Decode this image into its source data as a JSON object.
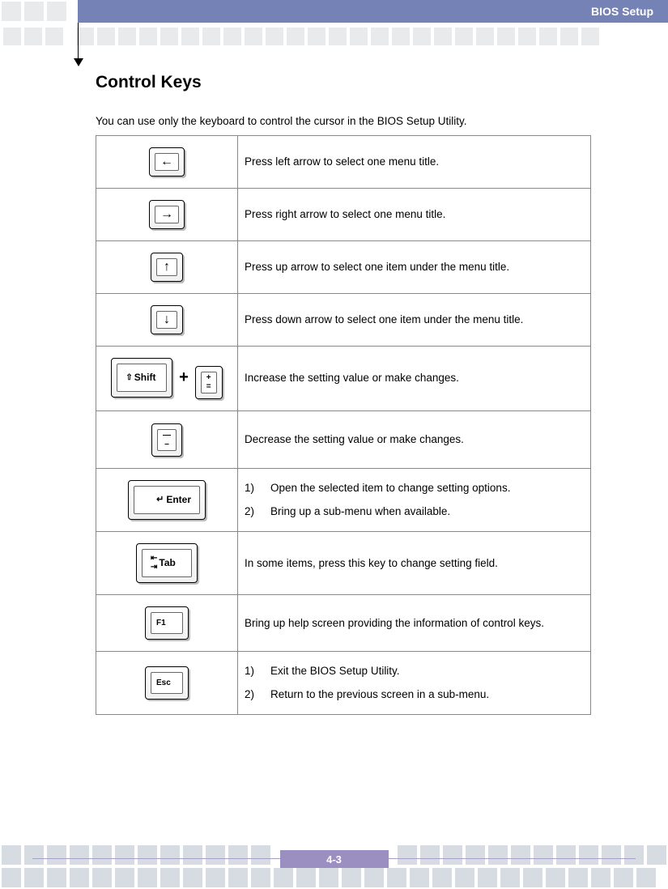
{
  "header": {
    "title": "BIOS Setup"
  },
  "page": {
    "title": "Control Keys",
    "intro": "You can use only the keyboard to control the cursor in the BIOS Setup Utility."
  },
  "keys": {
    "left": {
      "symbol": "←",
      "desc": "Press left arrow to select one menu title."
    },
    "right": {
      "symbol": "→",
      "desc": "Press right arrow to select one menu title."
    },
    "up": {
      "symbol": "↑",
      "desc": "Press up arrow to select one item under the menu title."
    },
    "down": {
      "symbol": "↓",
      "desc": "Press down arrow to select one item under the menu title."
    },
    "shift_label": "Shift",
    "plus_top": "+",
    "plus_bottom": "=",
    "increase_desc": "Increase the setting value or make changes.",
    "minus_top": "—",
    "minus_bottom": "–",
    "decrease_desc": "Decrease the setting value or make changes.",
    "enter_label": "Enter",
    "enter_item1": "Open the selected item to change setting options.",
    "enter_item2": "Bring up a sub-menu when available.",
    "tab_label": "Tab",
    "tab_desc": "In some items, press this key to change setting field.",
    "f1_label": "F1",
    "f1_desc": "Bring up help screen providing the information of control keys.",
    "esc_label": "Esc",
    "esc_item1": "Exit the BIOS Setup Utility.",
    "esc_item2": "Return to the previous screen in a sub-menu."
  },
  "footer": {
    "page_num": "4-3"
  }
}
